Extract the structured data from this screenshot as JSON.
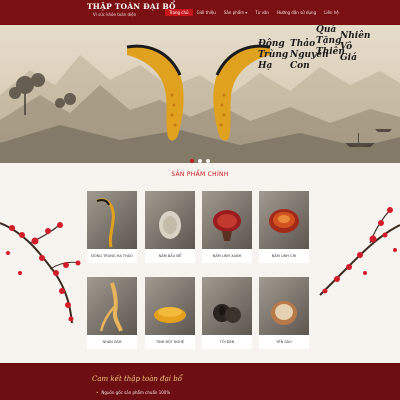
{
  "header": {
    "logo_title": "THẬP TOÀN ĐẠI BỔ",
    "logo_subtitle": "Vì sức khỏe toàn diện",
    "nav": [
      {
        "label": "Trang chủ",
        "active": true
      },
      {
        "label": "Giới thiệu",
        "active": false
      },
      {
        "label": "Sản phẩm ▾",
        "active": false
      },
      {
        "label": "Tư vấn",
        "active": false
      },
      {
        "label": "Hướng dẫn sử dụng",
        "active": false
      },
      {
        "label": "Liên hệ",
        "active": false
      }
    ],
    "colors": {
      "bar": "#7a1012",
      "active": "#c8141b"
    }
  },
  "hero": {
    "left_poem": [
      "Đông",
      "Trùng",
      "Hạ",
      "Thảo",
      "Nguyên",
      "Con"
    ],
    "right_poem": [
      "Quà",
      "Tặng",
      "Thiên",
      "Nhiên",
      "Vô",
      "Giá"
    ],
    "slides": 3,
    "active_slide": 0
  },
  "products": {
    "title": "SẢN PHẨM CHÍNH",
    "items": [
      {
        "label": "ĐÔNG TRÙNG HẠ THẢO",
        "icon": "cordyceps-icon"
      },
      {
        "label": "NẤM BẦU ĐỂ",
        "icon": "mushroom-icon"
      },
      {
        "label": "NẤM LINH XANH",
        "icon": "reishi-icon"
      },
      {
        "label": "NẤM LINH CHI",
        "icon": "lingzhi-icon"
      },
      {
        "label": "NHÂN SÂM",
        "icon": "ginseng-icon"
      },
      {
        "label": "TINH BỘT NGHỆ",
        "icon": "turmeric-icon"
      },
      {
        "label": "TỎI ĐEN",
        "icon": "black-garlic-icon"
      },
      {
        "label": "YẾN SÀO",
        "icon": "bird-nest-icon"
      }
    ]
  },
  "commitment": {
    "title": "Cam kết thập toàn đại bổ",
    "items": [
      "Nguồn gốc sản phẩm chuẩn 100%"
    ]
  }
}
